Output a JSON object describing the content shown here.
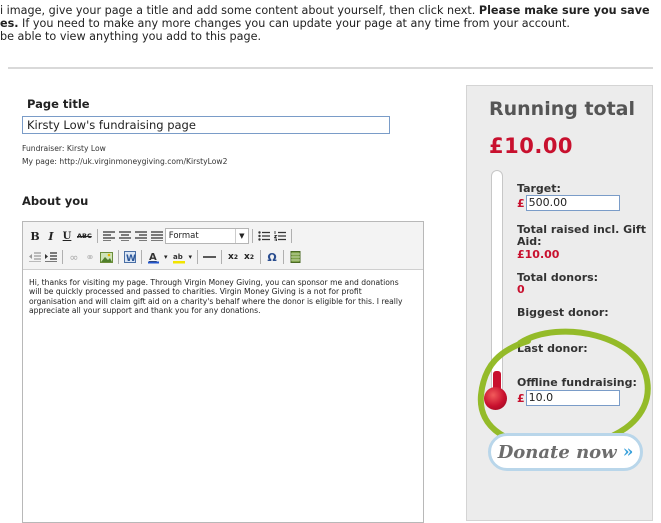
{
  "intro": {
    "line1": "i image, give your page a title and add some content about yourself, then click next. ",
    "line1_bold": "Please make sure you save",
    "line2_bold": "es.",
    "line2": " If you need to make any more changes you can update your page at any time from your account.",
    "line3": " be able to view anything you add to this page."
  },
  "form": {
    "page_title_label": "Page title",
    "page_title_value": "Kirsty Low's fundraising page",
    "fundraiser_line": "Fundraiser: Kirsty Low",
    "mypage_line": "My page: http://uk.virginmoneygiving.com/KirstyLow2",
    "about_label": "About you",
    "format_select": "Format",
    "about_text": "Hi, thanks for visiting my page. Through Virgin Money Giving, you can sponsor me and donations will be quickly processed and passed to charities. Virgin Money Giving is a not for profit organisation and will claim gift aid on a charity's behalf where the donor is eligible for this. I really appreciate all your support and thank you for any donations."
  },
  "panel": {
    "title": "Running total",
    "amount": "£10.00",
    "target_label": "Target:",
    "currency": "£",
    "target_value": "500.00",
    "raised_label": "Total raised incl. Gift Aid:",
    "raised_value": "£10.00",
    "donors_label": "Total donors:",
    "donors_value": "0",
    "biggest_label": "Biggest donor:",
    "last_label": "Last donor:",
    "offline_label": "Offline fundraising:",
    "offline_value": "10.0",
    "donate_label": "Donate now",
    "donate_chevron": "»"
  },
  "colors": {
    "accent_red": "#c8102e",
    "highlight_green": "#8fb81f",
    "donate_border": "#b9d6ea"
  },
  "icons": [
    "bold-icon",
    "italic-icon",
    "underline-icon",
    "strikethrough-icon",
    "align-left-icon",
    "align-center-icon",
    "align-right-icon",
    "align-justify-icon",
    "unordered-list-icon",
    "ordered-list-icon",
    "outdent-icon",
    "indent-icon",
    "link-icon",
    "unlink-icon",
    "image-icon",
    "paste-word-icon",
    "text-color-icon",
    "highlight-color-icon",
    "horizontal-rule-icon",
    "subscript-icon",
    "superscript-icon",
    "special-char-icon",
    "media-icon"
  ]
}
